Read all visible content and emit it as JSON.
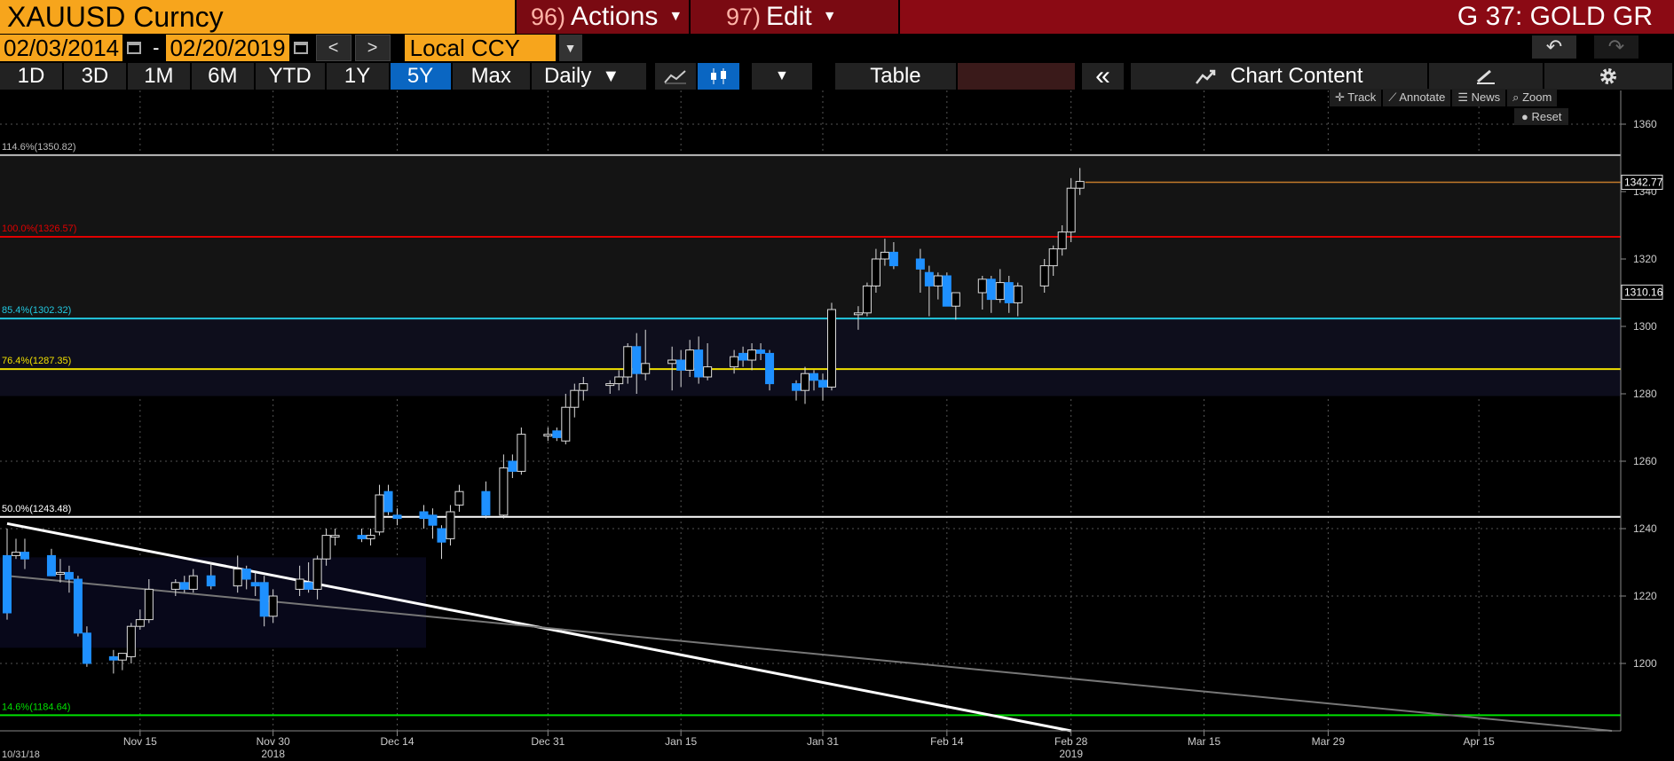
{
  "header": {
    "security": "XAUUSD Curncy",
    "actions_num": "96)",
    "actions_label": "Actions",
    "edit_num": "97)",
    "edit_label": "Edit",
    "page_title": "G 37: GOLD GR"
  },
  "daterange": {
    "start": "02/03/2014",
    "separator": "-",
    "end": "02/20/2019",
    "prev": "<",
    "next": ">",
    "currency": "Local CCY"
  },
  "toolbar": {
    "ranges": [
      "1D",
      "3D",
      "1M",
      "6M",
      "YTD",
      "1Y",
      "5Y",
      "Max"
    ],
    "active_range": "5Y",
    "frequency": "Daily",
    "table_label": "Table",
    "collapse": "«",
    "chart_content": "Chart Content"
  },
  "chart_tools": {
    "track": "Track",
    "annotate": "Annotate",
    "news": "News",
    "zoom": "Zoom",
    "reset": "Reset"
  },
  "colors": {
    "up": "#000000",
    "down": "#1e90ff",
    "accent": "#f7a51c",
    "menu": "#7a0a12"
  },
  "chart_data": {
    "type": "candlestick",
    "ylim": [
      1180,
      1370
    ],
    "yticks": [
      1200,
      1220,
      1240,
      1260,
      1280,
      1300,
      1320,
      1340,
      1360
    ],
    "xlim": [
      "2018-10-31",
      "2019-05-01"
    ],
    "xticks": [
      {
        "date": "2018-11-15",
        "label": "Nov 15"
      },
      {
        "date": "2018-11-30",
        "label": "Nov 30"
      },
      {
        "date": "2018-12-14",
        "label": "Dec 14"
      },
      {
        "date": "2018-12-31",
        "label": "Dec 31"
      },
      {
        "date": "2019-01-15",
        "label": "Jan 15"
      },
      {
        "date": "2019-01-31",
        "label": "Jan 31"
      },
      {
        "date": "2019-02-14",
        "label": "Feb 14"
      },
      {
        "date": "2019-02-28",
        "label": "Feb 28"
      },
      {
        "date": "2019-03-15",
        "label": "Mar 15"
      },
      {
        "date": "2019-03-29",
        "label": "Mar 29"
      },
      {
        "date": "2019-04-15",
        "label": "Apr 15"
      }
    ],
    "year_labels": [
      {
        "date": "2018-11-30",
        "label": "2018"
      },
      {
        "date": "2019-02-28",
        "label": "2019"
      }
    ],
    "start_date_label": {
      "date": "2018-10-31",
      "label": "10/31/18"
    },
    "last_price": 1342.77,
    "last_price_label": "1342.77",
    "marker_price": 1310.16,
    "marker_price_label": "1310.16",
    "fib_levels": [
      {
        "label": "114.6%(1350.82)",
        "value": 1350.82,
        "color": "#bbbbbb"
      },
      {
        "label": "100.0%(1326.57)",
        "value": 1326.57,
        "color": "#e00000"
      },
      {
        "label": "85.4%(1302.32)",
        "value": 1302.32,
        "color": "#22c8e0"
      },
      {
        "label": "76.4%(1287.35)",
        "value": 1287.35,
        "color": "#f0e000"
      },
      {
        "label": "50.0%(1243.48)",
        "value": 1243.48,
        "color": "#ffffff"
      },
      {
        "label": "14.6%(1184.64)",
        "value": 1184.64,
        "color": "#00e000"
      }
    ],
    "trendlines": [
      {
        "from": [
          "2018-10-31",
          1241.5
        ],
        "to": [
          "2019-02-28",
          1180
        ],
        "color": "#ffffff"
      },
      {
        "from": [
          "2018-10-31",
          1226
        ],
        "to": [
          "2019-04-30",
          1180
        ],
        "color": "#777777"
      }
    ],
    "candles": [
      {
        "date": "2018-10-31",
        "o": 1232,
        "h": 1240,
        "l": 1213,
        "c": 1215
      },
      {
        "date": "2018-11-01",
        "o": 1232,
        "h": 1237,
        "l": 1231,
        "c": 1233
      },
      {
        "date": "2018-11-02",
        "o": 1233,
        "h": 1237,
        "l": 1228,
        "c": 1231
      },
      {
        "date": "2018-11-05",
        "o": 1232,
        "h": 1234,
        "l": 1227,
        "c": 1226
      },
      {
        "date": "2018-11-06",
        "o": 1227,
        "h": 1231,
        "l": 1224,
        "c": 1227
      },
      {
        "date": "2018-11-07",
        "o": 1227,
        "h": 1229,
        "l": 1221,
        "c": 1225
      },
      {
        "date": "2018-11-08",
        "o": 1225,
        "h": 1226,
        "l": 1208,
        "c": 1209
      },
      {
        "date": "2018-11-09",
        "o": 1209,
        "h": 1211,
        "l": 1199,
        "c": 1200
      },
      {
        "date": "2018-11-12",
        "o": 1202,
        "h": 1204,
        "l": 1197,
        "c": 1201
      },
      {
        "date": "2018-11-13",
        "o": 1201,
        "h": 1203,
        "l": 1198,
        "c": 1203
      },
      {
        "date": "2018-11-14",
        "o": 1202,
        "h": 1212,
        "l": 1200,
        "c": 1211
      },
      {
        "date": "2018-11-15",
        "o": 1211,
        "h": 1216,
        "l": 1210,
        "c": 1213
      },
      {
        "date": "2018-11-16",
        "o": 1213,
        "h": 1225,
        "l": 1212,
        "c": 1222
      },
      {
        "date": "2018-11-19",
        "o": 1222,
        "h": 1225,
        "l": 1220,
        "c": 1224
      },
      {
        "date": "2018-11-20",
        "o": 1224,
        "h": 1226,
        "l": 1221,
        "c": 1222
      },
      {
        "date": "2018-11-21",
        "o": 1222,
        "h": 1228,
        "l": 1221,
        "c": 1226
      },
      {
        "date": "2018-11-23",
        "o": 1226,
        "h": 1230,
        "l": 1222,
        "c": 1223
      },
      {
        "date": "2018-11-26",
        "o": 1223,
        "h": 1232,
        "l": 1221,
        "c": 1228
      },
      {
        "date": "2018-11-27",
        "o": 1228,
        "h": 1229,
        "l": 1222,
        "c": 1225
      },
      {
        "date": "2018-11-28",
        "o": 1224,
        "h": 1227,
        "l": 1220,
        "c": 1223
      },
      {
        "date": "2018-11-29",
        "o": 1224,
        "h": 1226,
        "l": 1211,
        "c": 1214
      },
      {
        "date": "2018-11-30",
        "o": 1214,
        "h": 1222,
        "l": 1212,
        "c": 1220
      },
      {
        "date": "2018-12-03",
        "o": 1222,
        "h": 1229,
        "l": 1220,
        "c": 1225
      },
      {
        "date": "2018-12-04",
        "o": 1224,
        "h": 1230,
        "l": 1221,
        "c": 1222
      },
      {
        "date": "2018-12-05",
        "o": 1222,
        "h": 1232,
        "l": 1219,
        "c": 1231
      },
      {
        "date": "2018-12-06",
        "o": 1231,
        "h": 1240,
        "l": 1229,
        "c": 1238
      },
      {
        "date": "2018-12-07",
        "o": 1238,
        "h": 1240,
        "l": 1235,
        "c": 1238
      },
      {
        "date": "2018-12-10",
        "o": 1238,
        "h": 1240,
        "l": 1236,
        "c": 1237
      },
      {
        "date": "2018-12-11",
        "o": 1237,
        "h": 1240,
        "l": 1235,
        "c": 1238
      },
      {
        "date": "2018-12-12",
        "o": 1239,
        "h": 1253,
        "l": 1238,
        "c": 1250
      },
      {
        "date": "2018-12-13",
        "o": 1251,
        "h": 1253,
        "l": 1244,
        "c": 1245
      },
      {
        "date": "2018-12-14",
        "o": 1244,
        "h": 1246,
        "l": 1241,
        "c": 1243
      },
      {
        "date": "2018-12-17",
        "o": 1245,
        "h": 1247,
        "l": 1240,
        "c": 1243
      },
      {
        "date": "2018-12-18",
        "o": 1244,
        "h": 1246,
        "l": 1237,
        "c": 1241
      },
      {
        "date": "2018-12-19",
        "o": 1240,
        "h": 1241,
        "l": 1231,
        "c": 1236
      },
      {
        "date": "2018-12-20",
        "o": 1237,
        "h": 1247,
        "l": 1235,
        "c": 1245
      },
      {
        "date": "2018-12-21",
        "o": 1247,
        "h": 1253,
        "l": 1245,
        "c": 1251
      },
      {
        "date": "2018-12-24",
        "o": 1251,
        "h": 1254,
        "l": 1243,
        "c": 1244
      },
      {
        "date": "2018-12-26",
        "o": 1244,
        "h": 1262,
        "l": 1243,
        "c": 1258
      },
      {
        "date": "2018-12-27",
        "o": 1260,
        "h": 1262,
        "l": 1255,
        "c": 1257
      },
      {
        "date": "2018-12-28",
        "o": 1257,
        "h": 1270,
        "l": 1256,
        "c": 1268
      },
      {
        "date": "2018-12-31",
        "o": 1268,
        "h": 1270,
        "l": 1266,
        "c": 1268
      },
      {
        "date": "2019-01-01",
        "o": 1269,
        "h": 1270,
        "l": 1266,
        "c": 1267
      },
      {
        "date": "2019-01-02",
        "o": 1266,
        "h": 1280,
        "l": 1265,
        "c": 1276
      },
      {
        "date": "2019-01-03",
        "o": 1276,
        "h": 1283,
        "l": 1273,
        "c": 1281
      },
      {
        "date": "2019-01-04",
        "o": 1281,
        "h": 1285,
        "l": 1278,
        "c": 1283
      },
      {
        "date": "2019-01-07",
        "o": 1283,
        "h": 1284,
        "l": 1280,
        "c": 1283
      },
      {
        "date": "2019-01-08",
        "o": 1283,
        "h": 1287,
        "l": 1281,
        "c": 1285
      },
      {
        "date": "2019-01-09",
        "o": 1285,
        "h": 1295,
        "l": 1283,
        "c": 1294
      },
      {
        "date": "2019-01-10",
        "o": 1294,
        "h": 1298,
        "l": 1280,
        "c": 1286
      },
      {
        "date": "2019-01-11",
        "o": 1286,
        "h": 1299,
        "l": 1284,
        "c": 1289
      },
      {
        "date": "2019-01-14",
        "o": 1289,
        "h": 1294,
        "l": 1281,
        "c": 1290
      },
      {
        "date": "2019-01-15",
        "o": 1290,
        "h": 1293,
        "l": 1282,
        "c": 1287
      },
      {
        "date": "2019-01-16",
        "o": 1287,
        "h": 1296,
        "l": 1285,
        "c": 1293
      },
      {
        "date": "2019-01-17",
        "o": 1293,
        "h": 1297,
        "l": 1283,
        "c": 1285
      },
      {
        "date": "2019-01-18",
        "o": 1285,
        "h": 1295,
        "l": 1284,
        "c": 1288
      },
      {
        "date": "2019-01-21",
        "o": 1288,
        "h": 1293,
        "l": 1286,
        "c": 1291
      },
      {
        "date": "2019-01-22",
        "o": 1292,
        "h": 1294,
        "l": 1288,
        "c": 1290
      },
      {
        "date": "2019-01-23",
        "o": 1290,
        "h": 1295,
        "l": 1287,
        "c": 1293
      },
      {
        "date": "2019-01-24",
        "o": 1293,
        "h": 1295,
        "l": 1290,
        "c": 1292
      },
      {
        "date": "2019-01-25",
        "o": 1292,
        "h": 1293,
        "l": 1281,
        "c": 1283
      },
      {
        "date": "2019-01-28",
        "o": 1283,
        "h": 1284,
        "l": 1278,
        "c": 1281
      },
      {
        "date": "2019-01-29",
        "o": 1281,
        "h": 1288,
        "l": 1277,
        "c": 1286
      },
      {
        "date": "2019-01-30",
        "o": 1286,
        "h": 1287,
        "l": 1281,
        "c": 1284
      },
      {
        "date": "2019-01-31",
        "o": 1284,
        "h": 1286,
        "l": 1278,
        "c": 1282
      },
      {
        "date": "2019-02-01",
        "o": 1282,
        "h": 1307,
        "l": 1281,
        "c": 1305
      },
      {
        "date": "2019-02-04",
        "o": 1304,
        "h": 1306,
        "l": 1299,
        "c": 1304
      },
      {
        "date": "2019-02-05",
        "o": 1304,
        "h": 1313,
        "l": 1303,
        "c": 1312
      },
      {
        "date": "2019-02-06",
        "o": 1312,
        "h": 1323,
        "l": 1310,
        "c": 1320
      },
      {
        "date": "2019-02-07",
        "o": 1320,
        "h": 1326,
        "l": 1318,
        "c": 1322
      },
      {
        "date": "2019-02-08",
        "o": 1322,
        "h": 1325,
        "l": 1317,
        "c": 1318
      },
      {
        "date": "2019-02-11",
        "o": 1320,
        "h": 1323,
        "l": 1310,
        "c": 1317
      },
      {
        "date": "2019-02-12",
        "o": 1316,
        "h": 1318,
        "l": 1303,
        "c": 1312
      },
      {
        "date": "2019-02-13",
        "o": 1312,
        "h": 1316,
        "l": 1308,
        "c": 1315
      },
      {
        "date": "2019-02-14",
        "o": 1315,
        "h": 1316,
        "l": 1307,
        "c": 1306
      },
      {
        "date": "2019-02-15",
        "o": 1306,
        "h": 1309,
        "l": 1302,
        "c": 1310
      },
      {
        "date": "2019-02-18",
        "o": 1310,
        "h": 1315,
        "l": 1305,
        "c": 1314
      },
      {
        "date": "2019-02-19",
        "o": 1314,
        "h": 1315,
        "l": 1304,
        "c": 1308
      },
      {
        "date": "2019-02-20",
        "o": 1308,
        "h": 1317,
        "l": 1307,
        "c": 1313
      },
      {
        "date": "2019-02-21",
        "o": 1313,
        "h": 1315,
        "l": 1304,
        "c": 1307
      },
      {
        "date": "2019-02-22",
        "o": 1307,
        "h": 1313,
        "l": 1303,
        "c": 1312
      },
      {
        "date": "2019-02-25",
        "o": 1312,
        "h": 1320,
        "l": 1310,
        "c": 1318
      },
      {
        "date": "2019-02-26",
        "o": 1318,
        "h": 1324,
        "l": 1315,
        "c": 1323
      },
      {
        "date": "2019-02-27",
        "o": 1323,
        "h": 1330,
        "l": 1321,
        "c": 1328
      },
      {
        "date": "2019-02-28",
        "o": 1328,
        "h": 1344,
        "l": 1325,
        "c": 1341
      },
      {
        "date": "2019-03-01",
        "o": 1341,
        "h": 1347,
        "l": 1339,
        "c": 1343
      }
    ]
  }
}
